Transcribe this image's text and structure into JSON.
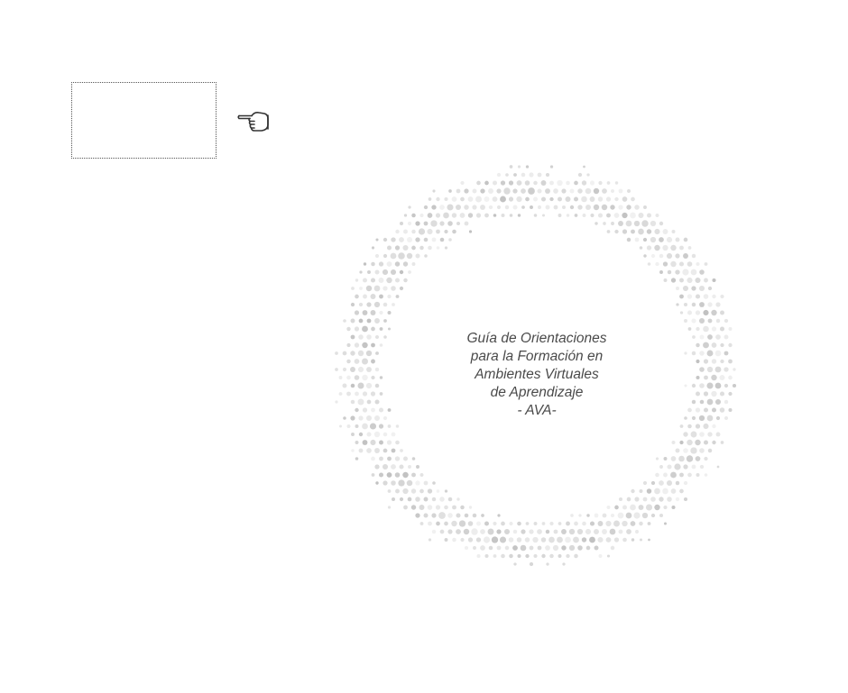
{
  "page": {
    "background_color": "#ffffff"
  },
  "placeholder_box": {
    "border_color": "#555555",
    "border_style": "dotted"
  },
  "pointer": {
    "icon": "pointing-hand-icon",
    "color": "#333333"
  },
  "cover": {
    "title_lines": [
      "Guía de Orientaciones",
      "para la Formación en",
      "Ambientes Virtuales",
      "de Aprendizaje",
      "- AVA-"
    ],
    "text_color": "#4a4a4a",
    "ring_icon": "dotted-ring-decoration",
    "ring_colors": [
      "#c8c8c8",
      "#d6d6d6",
      "#e2e2e2",
      "#bdbdbd"
    ]
  }
}
